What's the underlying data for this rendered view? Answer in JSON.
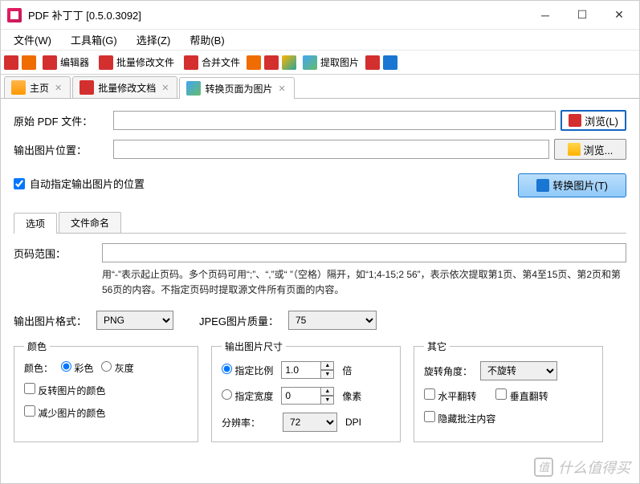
{
  "window": {
    "title": "PDF 补丁丁 [0.5.0.3092]"
  },
  "menu": {
    "file": "文件(W)",
    "toolbox": "工具箱(G)",
    "select": "选择(Z)",
    "help": "帮助(B)"
  },
  "toolbar": {
    "editor": "编辑器",
    "batchEdit": "批量修改文件",
    "merge": "合并文件",
    "extractImg": "提取图片"
  },
  "tabs": {
    "home": "主页",
    "batchEditDoc": "批量修改文档",
    "convertImg": "转换页面为图片"
  },
  "form": {
    "srcLabel": "原始 PDF 文件：",
    "outLabel": "输出图片位置：",
    "browseL": "浏览(L)",
    "browseDots": "浏览...",
    "autoLocate": "自动指定输出图片的位置",
    "convertBtn": "转换图片(T)"
  },
  "subtabs": {
    "options": "选项",
    "naming": "文件命名"
  },
  "pageRange": {
    "label": "页码范围：",
    "help": "用“-”表示起止页码。多个页码可用“;”、“,”或“ ”（空格）隔开，如“1;4-15;2 56”，表示依次提取第1页、第4至15页、第2页和第56页的内容。不指定页码时提取源文件所有页面的内容。"
  },
  "format": {
    "outFormatLabel": "输出图片格式：",
    "outFormatValue": "PNG",
    "jpegLabel": "JPEG图片质量：",
    "jpegValue": "75"
  },
  "groupColor": {
    "legend": "颜色",
    "colorLabel": "颜色：",
    "colorful": "彩色",
    "gray": "灰度",
    "invert": "反转图片的颜色",
    "reduce": "减少图片的颜色"
  },
  "groupSize": {
    "legend": "输出图片尺寸",
    "ratio": "指定比例",
    "ratioVal": "1.0",
    "ratioUnit": "倍",
    "width": "指定宽度",
    "widthVal": "0",
    "widthUnit": "像素",
    "dpi": "分辨率：",
    "dpiVal": "72",
    "dpiUnit": "DPI"
  },
  "groupOther": {
    "legend": "其它",
    "rotateLabel": "旋转角度：",
    "rotateValue": "不旋转",
    "flipH": "水平翻转",
    "flipV": "垂直翻转",
    "hideAnnot": "隐藏批注内容"
  },
  "watermark": "什么值得买"
}
